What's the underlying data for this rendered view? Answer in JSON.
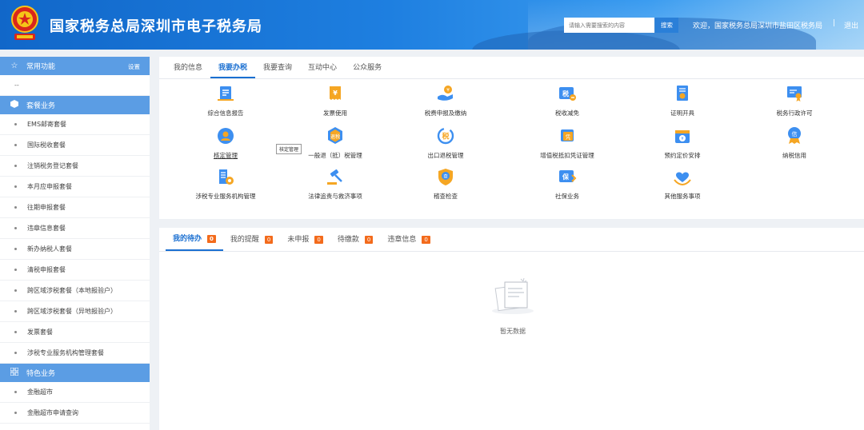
{
  "header": {
    "title": "国家税务总局深圳市电子税务局",
    "search_placeholder": "请输入需要搜索的内容",
    "search_button": "搜索",
    "welcome": "欢迎，国家税务总局深圳市盐田区税务局",
    "separator": "|",
    "logout": "退出"
  },
  "sidebar": {
    "common": {
      "label": "常用功能",
      "setting": "设置",
      "icon": "star-icon",
      "placeholder": "--"
    },
    "package": {
      "label": "套餐业务",
      "icon": "cube-icon",
      "items": [
        "EMS邮寄套餐",
        "国际税收套餐",
        "注销税务登记套餐",
        "本月应申报套餐",
        "往期申报套餐",
        "违章信息套餐",
        "新办纳税人套餐",
        "清税申报套餐",
        "跨区域涉税套餐（本地报验户）",
        "跨区域涉税套餐（异地报验户）",
        "发票套餐",
        "涉税专业服务机构管理套餐"
      ]
    },
    "special": {
      "label": "特色业务",
      "icon": "grid-icon",
      "items": [
        "金融超市",
        "金融超市申请查询"
      ]
    }
  },
  "main": {
    "tabs": [
      "我的信息",
      "我要办税",
      "我要查询",
      "互动中心",
      "公众服务"
    ],
    "active_tab": 1,
    "functions": [
      {
        "label": "综合信息报告",
        "icon": "report-icon"
      },
      {
        "label": "发票使用",
        "icon": "invoice-icon"
      },
      {
        "label": "税费申报及缴纳",
        "icon": "payment-icon"
      },
      {
        "label": "税收减免",
        "icon": "tax-relief-icon"
      },
      {
        "label": "证明开具",
        "icon": "certificate-icon"
      },
      {
        "label": "税务行政许可",
        "icon": "license-icon"
      },
      {
        "label": "核定管理",
        "icon": "assessment-icon"
      },
      {
        "label": "一般退（抵）税管理",
        "icon": "refund-icon"
      },
      {
        "label": "出口退税管理",
        "icon": "export-refund-icon"
      },
      {
        "label": "增值税抵扣凭证管理",
        "icon": "voucher-icon"
      },
      {
        "label": "预约定价安排",
        "icon": "calendar-price-icon"
      },
      {
        "label": "纳税信用",
        "icon": "credit-icon"
      },
      {
        "label": "涉税专业服务机构管理",
        "icon": "agency-icon"
      },
      {
        "label": "法律追责与救济事项",
        "icon": "gavel-icon"
      },
      {
        "label": "稽查检查",
        "icon": "shield-check-icon"
      },
      {
        "label": "社保业务",
        "icon": "social-security-icon"
      },
      {
        "label": "其他服务事项",
        "icon": "heart-hands-icon"
      }
    ],
    "tooltip": "核定管理"
  },
  "todo": {
    "tabs": [
      {
        "label": "我的待办",
        "count": "0"
      },
      {
        "label": "我的提醒",
        "count": "0"
      },
      {
        "label": "未申报",
        "count": "0"
      },
      {
        "label": "待缴款",
        "count": "0"
      },
      {
        "label": "违章信息",
        "count": "0"
      }
    ],
    "active_tab": 0,
    "empty_text": "暂无数据"
  },
  "colors": {
    "primary": "#1a6fd1",
    "sidebar_header": "#5b9de4",
    "badge": "#f36b1c",
    "icon_blue": "#3d8ff0",
    "icon_orange": "#f5a623"
  }
}
